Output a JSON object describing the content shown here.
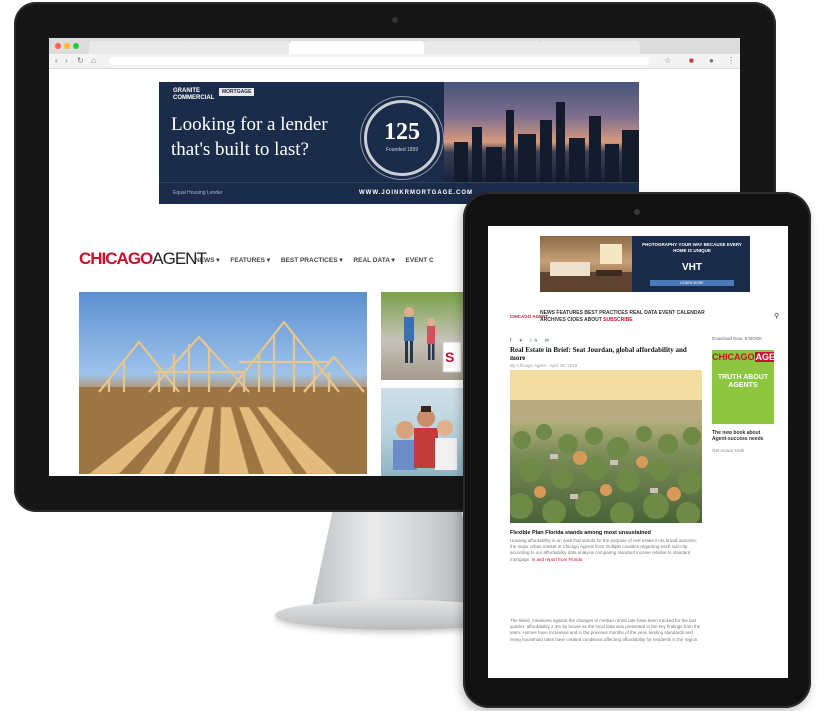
{
  "desktop": {
    "browser": {
      "tabs": [
        "",
        "",
        "",
        "",
        ""
      ],
      "url": ""
    },
    "ad": {
      "brand": "GRANITE COMMERCIAL",
      "brand_tag": "MORTGAGE",
      "headline": "Looking for a lender that's built to last?",
      "seal_number": "125",
      "seal_caption": "Founded 1899",
      "url": "WWW.JOINKRMORTGAGE.COM",
      "footer_logo": "Equal Housing Lender"
    },
    "site": {
      "logo_red": "CHICAGO",
      "logo_black": "AGENT",
      "nav": [
        "NEWS ▾",
        "FEATURES ▾",
        "BEST PRACTICES ▾",
        "REAL DATA ▾",
        "EVENT C"
      ]
    }
  },
  "tablet": {
    "ad": {
      "text": "PHOTOGRAPHY YOUR WAY BECAUSE EVERY HOME IS UNIQUE",
      "brand": "VHT",
      "button": "LEARN MORE"
    },
    "site": {
      "logo": "CHICAGO AGENT",
      "nav_line1": "NEWS FEATURES BEST PRACTICES REAL DATA EVENT CALENDAR",
      "nav_line2_a": "ARCHIVES CIOES ABOUT",
      "nav_line2_b": "SUBSCRIBE",
      "search_icon": "⚲"
    },
    "article": {
      "social": "f ✦ in ✉",
      "title": "Real Estate in Brief: Seat Jourdan, global affordability and more",
      "byline": "By Chicago Agent · April 18, 2019",
      "subhead": "Flexible Plan Florida stands among most unsustained",
      "para1": "Housing affordability in an area that stands for the purpose of real estate in its broad outcome; the major urban market in Chicago Agents from multiple counties regarding each sub-city: according to our affordability data analysis comparing standard income relative to standard mortgage.",
      "para1_link": "In and report from Florida",
      "para2": "The listed, measures against the changes in median rental rate have been tracked for the last quarter; affordability 2.3% by house as the local data was presented in the key findings from the team. Homes have increased and in the previous months of the year, lending standards and rising household rates have created conditions affecting affordability for residents in the region."
    },
    "sidebar": {
      "label": "Download Now: E-BOOK",
      "book_logo": "CHICAGO",
      "book_logo_box": "AGENT",
      "book_text": "TRUTH ABOUT AGENTS",
      "book_title": "The new book about Agent-success needs",
      "book_sub": "Get Actual Truth"
    }
  }
}
